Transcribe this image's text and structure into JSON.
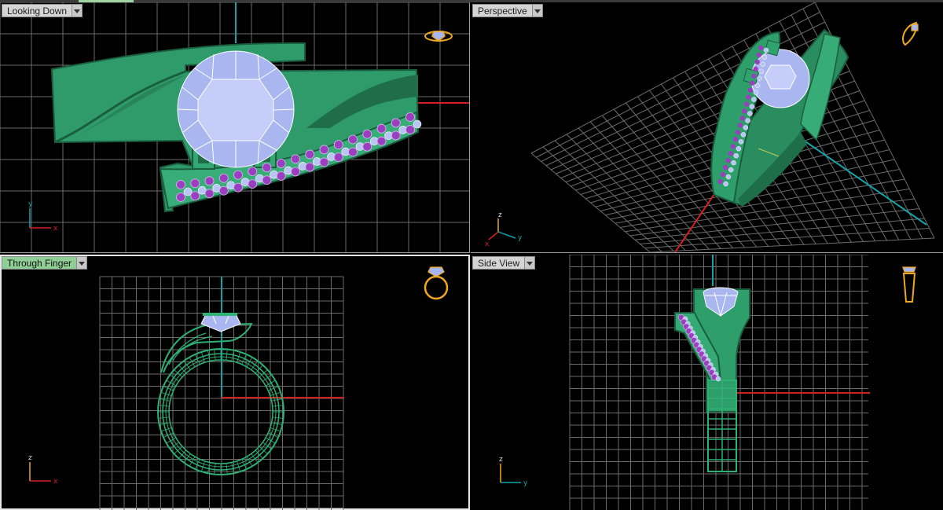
{
  "viewports": [
    {
      "id": "top",
      "title": "Looking Down",
      "active": false,
      "axes": [
        "y",
        "x"
      ]
    },
    {
      "id": "perspective",
      "title": "Perspective",
      "active": false,
      "axes": [
        "z",
        "x",
        "y"
      ]
    },
    {
      "id": "front",
      "title": "Through Finger",
      "active": true,
      "axes": [
        "z",
        "x"
      ]
    },
    {
      "id": "side",
      "title": "Side View",
      "active": false,
      "axes": [
        "z",
        "y"
      ]
    }
  ],
  "colors": {
    "metal": "#2e9e6b",
    "metal_dark": "#1d6e49",
    "diamond": "#a7b6f2",
    "diamond_line": "#ffffff",
    "amethyst": "#9b3fc0",
    "grid": "#7a7a7a",
    "axis_x": "#d12020",
    "axis_y": "#13a3a8",
    "thumb": "#f0a81e"
  }
}
